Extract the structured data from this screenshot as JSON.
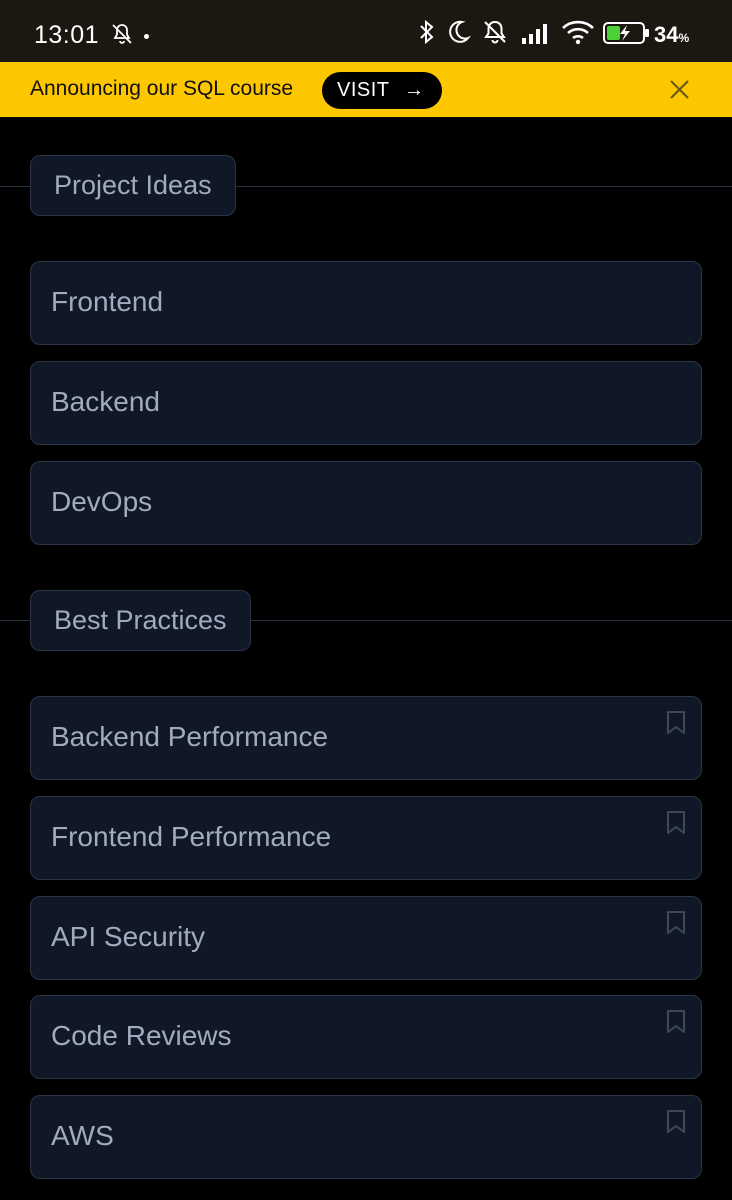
{
  "status_bar": {
    "time": "13:01",
    "battery_percent": "34",
    "battery_unit": "%",
    "icons": [
      "notifications-off-icon",
      "bluetooth-icon",
      "moon-icon",
      "silent-bell-icon",
      "signal-icon",
      "wifi-icon",
      "battery-charging-icon"
    ]
  },
  "banner": {
    "text": "Announcing our SQL course",
    "visit_label": "VISIT",
    "visit_arrow": "→",
    "background": "#fdc700"
  },
  "sections": {
    "project_ideas": {
      "title": "Project Ideas",
      "items": [
        "Frontend",
        "Backend",
        "DevOps"
      ]
    },
    "best_practices": {
      "title": "Best Practices",
      "items": [
        "Backend Performance",
        "Frontend Performance",
        "API Security",
        "Code Reviews",
        "AWS"
      ]
    }
  },
  "colors": {
    "page_background": "#000000",
    "card_background": "#101828",
    "card_border": "#2a3444",
    "text_muted": "#a1abbb"
  }
}
